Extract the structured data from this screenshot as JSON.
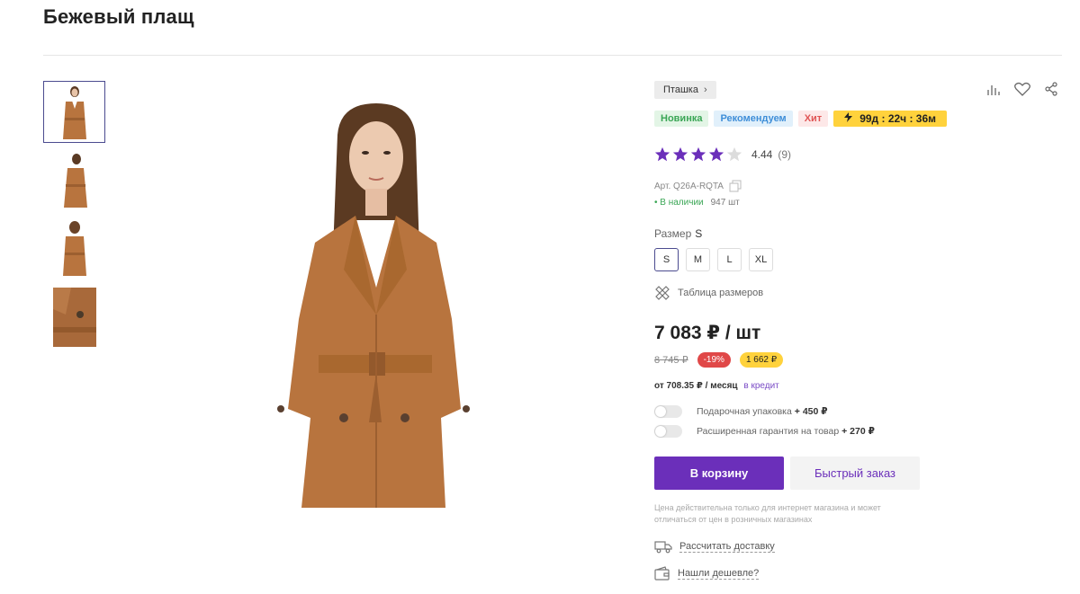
{
  "product": {
    "title": "Бежевый плащ",
    "brand": "Пташка",
    "badges": {
      "new": "Новинка",
      "recommended": "Рекомендуем",
      "hit": "Хит",
      "timer": "99д : 22ч : 36м"
    },
    "rating": {
      "value": "4.44",
      "count": "(9)",
      "stars_filled": 4,
      "stars_total": 5
    },
    "sku": "Арт. Q26A-RQTA",
    "stock": {
      "status": "• В наличии",
      "quantity": "947 шт"
    },
    "size": {
      "label": "Размер",
      "selected": "S",
      "options": [
        "S",
        "M",
        "L",
        "XL"
      ],
      "table_link": "Таблица размеров"
    },
    "price": {
      "current": "7 083 ₽ / шт",
      "old": "8 745 ₽",
      "discount": "-19%",
      "saving": "1 662 ₽"
    },
    "credit": {
      "amount": "от 708.35 ₽ / месяц",
      "link": "в кредит"
    },
    "options": [
      {
        "label": "Подарочная упаковка",
        "price": "+ 450 ₽"
      },
      {
        "label": "Расширенная гарантия на товар",
        "price": "+ 270 ₽"
      }
    ],
    "buttons": {
      "cart": "В корзину",
      "quick_order": "Быстрый заказ"
    },
    "note": "Цена действительна только для интернет магазина и может отличаться от цен в розничных магазинах",
    "links": {
      "delivery": "Рассчитать доставку",
      "cheaper": "Нашли дешевле?"
    }
  },
  "colors": {
    "accent": "#6b2fba",
    "star": "#6b2fba",
    "coat": "#b8743e"
  },
  "icons": [
    "compare-icon",
    "heart-icon",
    "share-icon",
    "copy-icon",
    "ruler-icon",
    "truck-icon",
    "wallet-icon",
    "lightning-icon",
    "chevron-right-icon",
    "star-icon"
  ]
}
